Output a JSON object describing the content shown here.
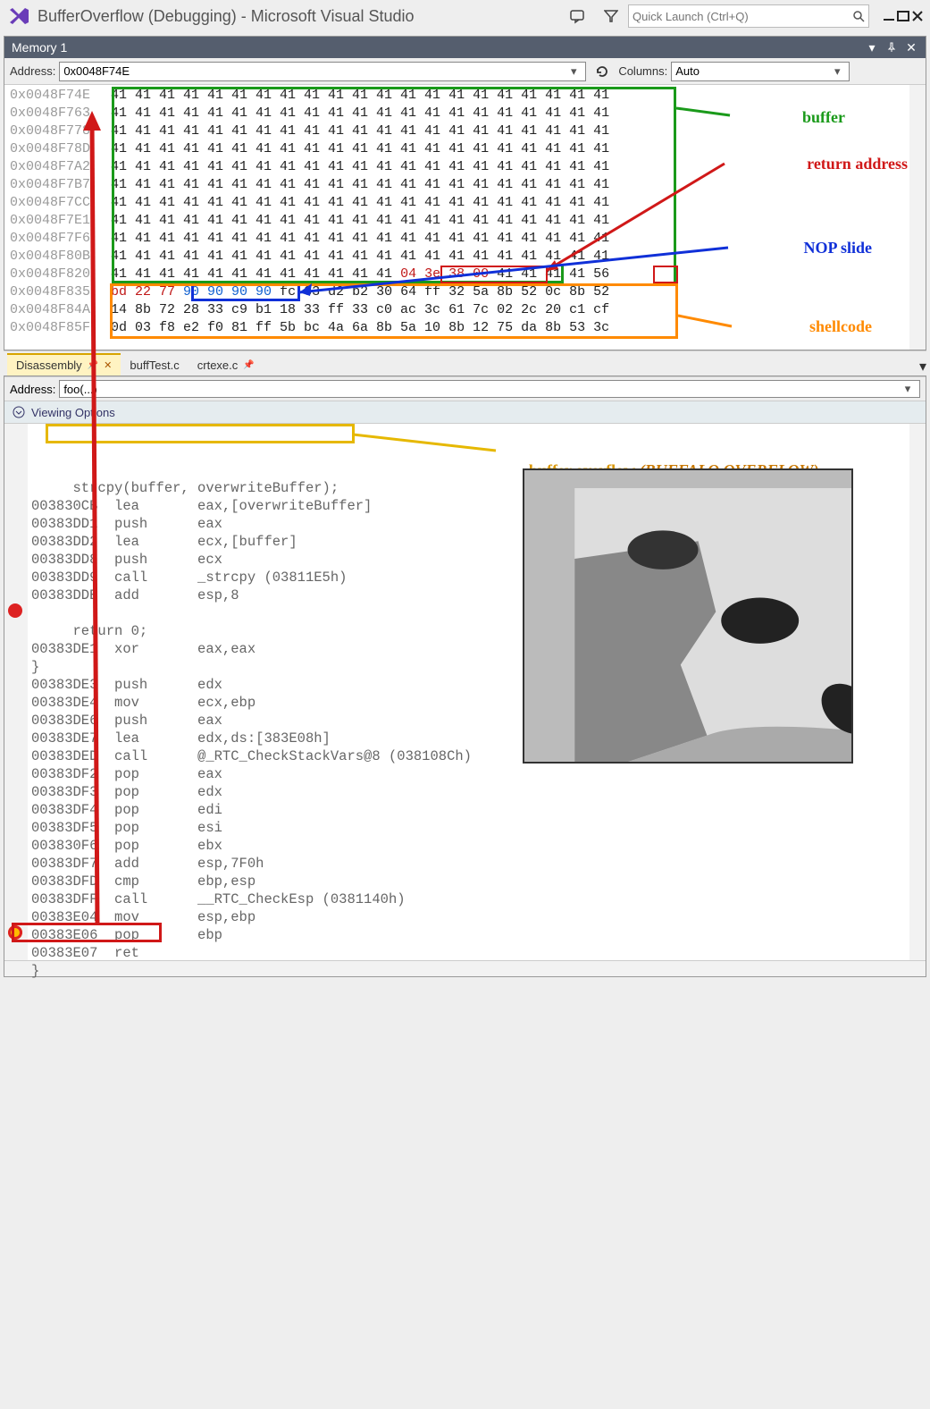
{
  "titlebar": {
    "title": "BufferOverflow (Debugging) - Microsoft Visual Studio",
    "quick_launch_placeholder": "Quick Launch (Ctrl+Q)"
  },
  "memory_panel": {
    "title": "Memory 1",
    "address_label": "Address:",
    "address_value": "0x0048F74E",
    "columns_label": "Columns:",
    "columns_value": "Auto",
    "rows": [
      {
        "addr": "0x0048F74E",
        "bytes": [
          "41",
          "41",
          "41",
          "41",
          "41",
          "41",
          "41",
          "41",
          "41",
          "41",
          "41",
          "41",
          "41",
          "41",
          "41",
          "41",
          "41",
          "41",
          "41",
          "41",
          "41"
        ]
      },
      {
        "addr": "0x0048F763",
        "bytes": [
          "41",
          "41",
          "41",
          "41",
          "41",
          "41",
          "41",
          "41",
          "41",
          "41",
          "41",
          "41",
          "41",
          "41",
          "41",
          "41",
          "41",
          "41",
          "41",
          "41",
          "41"
        ]
      },
      {
        "addr": "0x0048F778",
        "bytes": [
          "41",
          "41",
          "41",
          "41",
          "41",
          "41",
          "41",
          "41",
          "41",
          "41",
          "41",
          "41",
          "41",
          "41",
          "41",
          "41",
          "41",
          "41",
          "41",
          "41",
          "41"
        ]
      },
      {
        "addr": "0x0048F78D",
        "bytes": [
          "41",
          "41",
          "41",
          "41",
          "41",
          "41",
          "41",
          "41",
          "41",
          "41",
          "41",
          "41",
          "41",
          "41",
          "41",
          "41",
          "41",
          "41",
          "41",
          "41",
          "41"
        ]
      },
      {
        "addr": "0x0048F7A2",
        "bytes": [
          "41",
          "41",
          "41",
          "41",
          "41",
          "41",
          "41",
          "41",
          "41",
          "41",
          "41",
          "41",
          "41",
          "41",
          "41",
          "41",
          "41",
          "41",
          "41",
          "41",
          "41"
        ]
      },
      {
        "addr": "0x0048F7B7",
        "bytes": [
          "41",
          "41",
          "41",
          "41",
          "41",
          "41",
          "41",
          "41",
          "41",
          "41",
          "41",
          "41",
          "41",
          "41",
          "41",
          "41",
          "41",
          "41",
          "41",
          "41",
          "41"
        ]
      },
      {
        "addr": "0x0048F7CC",
        "bytes": [
          "41",
          "41",
          "41",
          "41",
          "41",
          "41",
          "41",
          "41",
          "41",
          "41",
          "41",
          "41",
          "41",
          "41",
          "41",
          "41",
          "41",
          "41",
          "41",
          "41",
          "41"
        ]
      },
      {
        "addr": "0x0048F7E1",
        "bytes": [
          "41",
          "41",
          "41",
          "41",
          "41",
          "41",
          "41",
          "41",
          "41",
          "41",
          "41",
          "41",
          "41",
          "41",
          "41",
          "41",
          "41",
          "41",
          "41",
          "41",
          "41"
        ]
      },
      {
        "addr": "0x0048F7F6",
        "bytes": [
          "41",
          "41",
          "41",
          "41",
          "41",
          "41",
          "41",
          "41",
          "41",
          "41",
          "41",
          "41",
          "41",
          "41",
          "41",
          "41",
          "41",
          "41",
          "41",
          "41",
          "41"
        ]
      },
      {
        "addr": "0x0048F80B",
        "bytes": [
          "41",
          "41",
          "41",
          "41",
          "41",
          "41",
          "41",
          "41",
          "41",
          "41",
          "41",
          "41",
          "41",
          "41",
          "41",
          "41",
          "41",
          "41",
          "41",
          "41",
          "41"
        ]
      },
      {
        "addr": "0x0048F820",
        "bytes_a": [
          "41",
          "41",
          "41",
          "41",
          "41",
          "41",
          "41",
          "41",
          "41",
          "41",
          "41",
          "41"
        ],
        "bytes_b": [
          "04",
          "3e",
          "38",
          "00"
        ],
        "bytes_c": [
          "41",
          "41",
          "41",
          "41"
        ],
        "bytes_d": [
          "56"
        ]
      },
      {
        "addr": "0x0048F835",
        "bytes_a": [
          "bd",
          "22",
          "77"
        ],
        "bytes_b": [
          "90",
          "90",
          "90",
          "90"
        ],
        "bytes_c": [
          "fc",
          "33",
          "d2",
          "b2",
          "30",
          "64",
          "ff",
          "32",
          "5a",
          "8b",
          "52",
          "0c",
          "8b",
          "52"
        ]
      },
      {
        "addr": "0x0048F84A",
        "bytes": [
          "14",
          "8b",
          "72",
          "28",
          "33",
          "c9",
          "b1",
          "18",
          "33",
          "ff",
          "33",
          "c0",
          "ac",
          "3c",
          "61",
          "7c",
          "02",
          "2c",
          "20",
          "c1",
          "cf"
        ]
      },
      {
        "addr": "0x0048F85F",
        "bytes": [
          "0d",
          "03",
          "f8",
          "e2",
          "f0",
          "81",
          "ff",
          "5b",
          "bc",
          "4a",
          "6a",
          "8b",
          "5a",
          "10",
          "8b",
          "12",
          "75",
          "da",
          "8b",
          "53",
          "3c"
        ]
      }
    ]
  },
  "annotations": {
    "buffer": "buffer",
    "return_address": "return address",
    "nop_slide": "NOP slide",
    "shellcode": "shellcode",
    "buffer_overflow": "buffer overflow",
    "buffalo": "(BUFFALO OVERFLOW)"
  },
  "tabs": {
    "disassembly": "Disassembly",
    "buffTest": "buffTest.c",
    "crtexe": "crtexe.c"
  },
  "disassembly": {
    "address_label": "Address:",
    "address_value": "foo(...)",
    "viewing_options": "Viewing Options",
    "srcline1": "     strcpy(buffer, overwriteBuffer);",
    "lines": [
      {
        "addr": "003830CB",
        "op": "lea",
        "args": "eax,[overwriteBuffer]"
      },
      {
        "addr": "00383DD1",
        "op": "push",
        "args": "eax"
      },
      {
        "addr": "00383DD2",
        "op": "lea",
        "args": "ecx,[buffer]"
      },
      {
        "addr": "00383DD8",
        "op": "push",
        "args": "ecx"
      },
      {
        "addr": "00383DD9",
        "op": "call",
        "args": "_strcpy (03811E5h)"
      },
      {
        "addr": "00383DDE",
        "op": "add",
        "args": "esp,8"
      }
    ],
    "srcline2": "     return 0;",
    "lines2": [
      {
        "addr": "00383DE1",
        "op": "xor",
        "args": "eax,eax"
      }
    ],
    "brace1": "}",
    "lines3": [
      {
        "addr": "00383DE3",
        "op": "push",
        "args": "edx"
      },
      {
        "addr": "00383DE4",
        "op": "mov",
        "args": "ecx,ebp"
      },
      {
        "addr": "00383DE6",
        "op": "push",
        "args": "eax"
      },
      {
        "addr": "00383DE7",
        "op": "lea",
        "args": "edx,ds:[383E08h]"
      },
      {
        "addr": "00383DED",
        "op": "call",
        "args": "@_RTC_CheckStackVars@8 (038108Ch)"
      },
      {
        "addr": "00383DF2",
        "op": "pop",
        "args": "eax"
      },
      {
        "addr": "00383DF3",
        "op": "pop",
        "args": "edx"
      },
      {
        "addr": "00383DF4",
        "op": "pop",
        "args": "edi"
      },
      {
        "addr": "00383DF5",
        "op": "pop",
        "args": "esi"
      },
      {
        "addr": "003830F6",
        "op": "pop",
        "args": "ebx"
      },
      {
        "addr": "00383DF7",
        "op": "add",
        "args": "esp,7F0h"
      },
      {
        "addr": "00383DFD",
        "op": "cmp",
        "args": "ebp,esp"
      },
      {
        "addr": "00383DFF",
        "op": "call",
        "args": "__RTC_CheckEsp (0381140h)"
      },
      {
        "addr": "00383E04",
        "op": "mov",
        "args": "esp,ebp"
      },
      {
        "addr": "00383E06",
        "op": "pop",
        "args": "ebp"
      },
      {
        "addr": "00383E07",
        "op": "ret",
        "args": ""
      }
    ],
    "brace2": "}"
  }
}
